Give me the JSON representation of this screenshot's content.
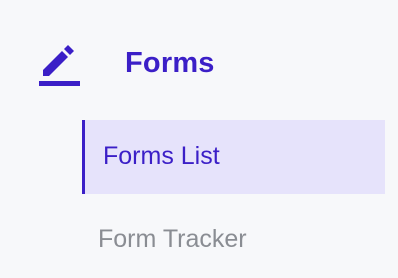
{
  "section": {
    "title": "Forms",
    "icon": "pencil-icon",
    "accent_color": "#3b1fc7"
  },
  "items": [
    {
      "label": "Forms List",
      "active": true
    },
    {
      "label": "Form Tracker",
      "active": false
    }
  ],
  "colors": {
    "background": "#f7f8fa",
    "active_background": "#e6e3fb",
    "inactive_text": "#8a8d93"
  }
}
